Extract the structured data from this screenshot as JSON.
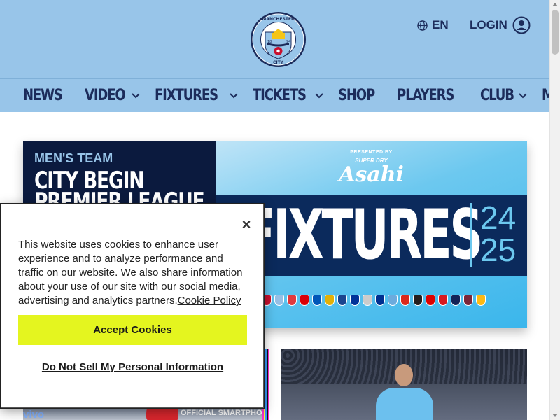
{
  "header": {
    "crest_text": {
      "top": "MANCHESTER",
      "bottom": "CITY",
      "left_year": "18",
      "right_year": "94"
    },
    "language_label": "EN",
    "login_label": "LOGIN",
    "icons": {
      "language": "globe-icon",
      "login": "user-circle-icon"
    }
  },
  "nav": {
    "items": [
      {
        "label": "NEWS",
        "dropdown": false
      },
      {
        "label": "VIDEO",
        "dropdown": true
      },
      {
        "label": "FIXTURES",
        "dropdown": true
      },
      {
        "label": "TICKETS",
        "dropdown": true
      },
      {
        "label": "SHOP",
        "dropdown": false
      },
      {
        "label": "PLAYERS",
        "dropdown": false
      },
      {
        "label": "CLUB",
        "dropdown": true
      },
      {
        "label": "MORE",
        "dropdown": true
      }
    ]
  },
  "hero": {
    "category": "MEN'S TEAM",
    "title": "CITY BEGIN PREMIER LEAGUE DEFENCE AT",
    "image": {
      "presented_by": "PRESENTED BY",
      "brand_top": "SUPER DRY",
      "brand": "Asahi",
      "headline": "FIXTURES",
      "season_top": "24",
      "season_bottom": "25"
    }
  },
  "cards": {
    "left": {
      "sponsor_text": "vivo",
      "overlay_text": "OFFICIAL SMARTPHO"
    },
    "right": {}
  },
  "cookie_banner": {
    "text": "This website uses cookies to enhance user experience and to analyze performance and traffic on our website. We also share information about your use of our site with our social media, advertising and analytics partners.",
    "policy_link": "Cookie Policy",
    "accept_label": "Accept Cookies",
    "do_not_sell_label": "Do Not Sell My Personal Information",
    "close_symbol": "×"
  },
  "colors": {
    "header_bg": "#98c5e9",
    "navy": "#1c2c5b",
    "hero_dark": "#0b1a3e",
    "accept_yellow": "#e4f51f"
  },
  "badge_colors": [
    "#c8102e",
    "#95bfe5",
    "#e03a3e",
    "#db0007",
    "#0057b8",
    "#e2b007",
    "#1b458f",
    "#003399",
    "#cccccc",
    "#003090",
    "#6cabdd",
    "#da291c",
    "#241f20",
    "#dd0000",
    "#d71920",
    "#132257",
    "#7a263a",
    "#fdb913"
  ]
}
